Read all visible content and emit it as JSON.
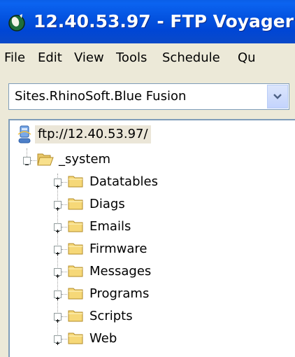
{
  "window": {
    "title": "12.40.53.97 - FTP Voyager",
    "title_icon": "ftp-voyager-app-icon",
    "title_bar_color": "#0054e3"
  },
  "menu": {
    "items": [
      "File",
      "Edit",
      "View",
      "Tools",
      "Schedule",
      "Qu"
    ]
  },
  "site_selector": {
    "value": "Sites.RhinoSoft.Blue Fusion",
    "button_icon": "chevron-down-icon"
  },
  "tree": {
    "root": {
      "label": "ftp://12.40.53.97/",
      "icon": "server-icon"
    },
    "system_folder": {
      "label": "_system",
      "icon": "folder-open-icon",
      "expanded": true
    },
    "children": [
      {
        "label": "Datatables",
        "icon": "folder-icon"
      },
      {
        "label": "Diags",
        "icon": "folder-icon"
      },
      {
        "label": "Emails",
        "icon": "folder-icon"
      },
      {
        "label": "Firmware",
        "icon": "folder-icon"
      },
      {
        "label": "Messages",
        "icon": "folder-icon"
      },
      {
        "label": "Programs",
        "icon": "folder-icon"
      },
      {
        "label": "Scripts",
        "icon": "folder-icon"
      },
      {
        "label": "Web",
        "icon": "folder-icon"
      }
    ]
  }
}
